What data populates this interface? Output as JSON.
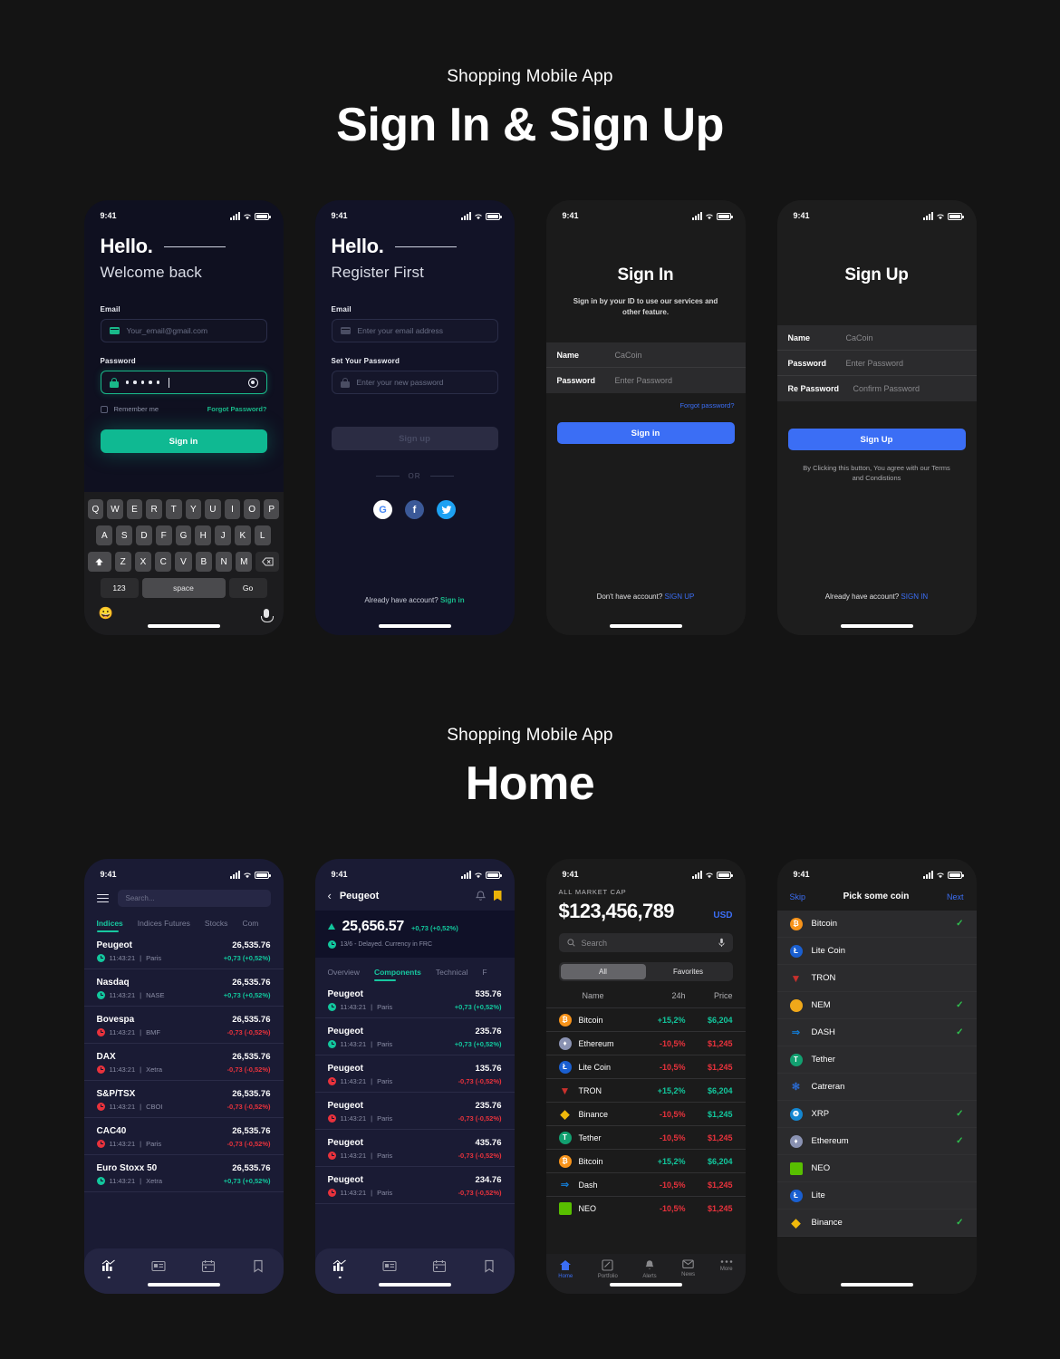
{
  "sections": [
    {
      "subtitle": "Shopping Mobile App",
      "title": "Sign In & Sign Up"
    },
    {
      "subtitle": "Shopping Mobile App",
      "title": "Home"
    }
  ],
  "status_bar": {
    "time": "9:41"
  },
  "screen_signin_dark": {
    "hello": "Hello.",
    "welcome": "Welcome back",
    "email_label": "Email",
    "email_placeholder": "Your_email@gmail.com",
    "email_icon": "mail-icon",
    "password_label": "Password",
    "password_icon": "lock-icon",
    "password_masked": "•••••",
    "eye_icon": "eye-icon",
    "remember_label": "Remember me",
    "forgot_label": "Forgot Password?",
    "signin_button": "Sign in",
    "accent": "#0fb992",
    "keyboard": {
      "row1": [
        "Q",
        "W",
        "E",
        "R",
        "T",
        "Y",
        "U",
        "I",
        "O",
        "P"
      ],
      "row2": [
        "A",
        "S",
        "D",
        "F",
        "G",
        "H",
        "J",
        "K",
        "L"
      ],
      "row3": [
        "Z",
        "X",
        "C",
        "V",
        "B",
        "N",
        "M"
      ],
      "shift_icon": "shift-icon",
      "backspace_icon": "backspace-icon",
      "numbers_key": "123",
      "space_key": "space",
      "go_key": "Go",
      "emoji_icon": "emoji-icon",
      "mic_icon": "microphone-icon"
    }
  },
  "screen_signup_dark": {
    "hello": "Hello.",
    "register": "Register First",
    "email_label": "Email",
    "email_placeholder": "Enter your email address",
    "password_label": "Set Your Password",
    "password_placeholder": "Enter your new password",
    "signup_button": "Sign up",
    "or_label": "OR",
    "socials": [
      {
        "name": "google-icon",
        "glyph": "G",
        "color": "#ffffff"
      },
      {
        "name": "facebook-icon",
        "glyph": "f",
        "color": "#3b5998"
      },
      {
        "name": "twitter-icon",
        "glyph": "t",
        "color": "#1da1f2"
      }
    ],
    "bottom_text": "Already have account?",
    "bottom_link": "Sign in"
  },
  "screen_ios_signin": {
    "title": "Sign In",
    "subtitle": "Sign in by your ID to use our services and other feature.",
    "fields": [
      {
        "label": "Name",
        "value": "CaCoin"
      },
      {
        "label": "Password",
        "value": "Enter Password"
      }
    ],
    "forgot": "Forgot password?",
    "button": "Sign in",
    "bottom_text": "Don't have account?",
    "bottom_link": "SIGN UP",
    "accent": "#3b6ef5"
  },
  "screen_ios_signup": {
    "title": "Sign Up",
    "fields": [
      {
        "label": "Name",
        "value": "CaCoin"
      },
      {
        "label": "Password",
        "value": "Enter Password"
      },
      {
        "label": "Re Password",
        "value": "Confirm Password"
      }
    ],
    "button": "Sign Up",
    "terms": "By Clicking this button, You agree with our Terms and Condistions",
    "bottom_text": "Already have account?",
    "bottom_link": "SIGN IN"
  },
  "screen_home_indices": {
    "menu_icon": "hamburger-icon",
    "search_placeholder": "Search...",
    "tabs": [
      "Indices",
      "Indices Futures",
      "Stocks",
      "Com"
    ],
    "active_tab": "Indices",
    "rows": [
      {
        "name": "Peugeot",
        "price": "26,535.76",
        "time": "11:43:21",
        "market": "Paris",
        "change": "+0,73 (+0,52%)",
        "dir": "up"
      },
      {
        "name": "Nasdaq",
        "price": "26,535.76",
        "time": "11:43:21",
        "market": "NASE",
        "change": "+0,73 (+0,52%)",
        "dir": "up"
      },
      {
        "name": "Bovespa",
        "price": "26,535.76",
        "time": "11:43:21",
        "market": "BMF",
        "change": "-0,73 (-0,52%)",
        "dir": "down"
      },
      {
        "name": "DAX",
        "price": "26,535.76",
        "time": "11:43:21",
        "market": "Xetra",
        "change": "-0,73 (-0,52%)",
        "dir": "down"
      },
      {
        "name": "S&P/TSX",
        "price": "26,535.76",
        "time": "11:43:21",
        "market": "CBOI",
        "change": "-0,73 (-0,52%)",
        "dir": "down"
      },
      {
        "name": "CAC40",
        "price": "26,535.76",
        "time": "11:43:21",
        "market": "Paris",
        "change": "-0,73 (-0,52%)",
        "dir": "down"
      },
      {
        "name": "Euro Stoxx 50",
        "price": "26,535.76",
        "time": "11:43:21",
        "market": "Xetra",
        "change": "+0,73 (+0,52%)",
        "dir": "up"
      }
    ],
    "nav_icons": [
      "chart-icon",
      "news-icon",
      "calendar-icon",
      "bookmark-icon"
    ]
  },
  "screen_home_detail": {
    "back_icon": "chevron-left-icon",
    "title": "Peugeot",
    "bell_icon": "bell-icon",
    "bookmark_icon": "bookmark-icon",
    "price": "25,656.57",
    "change": "+0,73 (+0,52%)",
    "meta": "13/6 - Delayed. Currency in FRC",
    "tabs": [
      "Overview",
      "Components",
      "Technical",
      "F"
    ],
    "active_tab": "Components",
    "rows": [
      {
        "name": "Peugeot",
        "price": "535.76",
        "time": "11:43:21",
        "market": "Paris",
        "change": "+0,73 (+0,52%)",
        "dir": "up"
      },
      {
        "name": "Peugeot",
        "price": "235.76",
        "time": "11:43:21",
        "market": "Paris",
        "change": "+0,73 (+0,52%)",
        "dir": "up"
      },
      {
        "name": "Peugeot",
        "price": "135.76",
        "time": "11:43:21",
        "market": "Paris",
        "change": "-0,73 (-0,52%)",
        "dir": "down"
      },
      {
        "name": "Peugeot",
        "price": "235.76",
        "time": "11:43:21",
        "market": "Paris",
        "change": "-0,73 (-0,52%)",
        "dir": "down"
      },
      {
        "name": "Peugeot",
        "price": "435.76",
        "time": "11:43:21",
        "market": "Paris",
        "change": "-0,73 (-0,52%)",
        "dir": "down"
      },
      {
        "name": "Peugeot",
        "price": "234.76",
        "time": "11:43:21",
        "market": "Paris",
        "change": "-0,73 (-0,52%)",
        "dir": "down"
      }
    ]
  },
  "screen_market_cap": {
    "label": "ALL MARKET CAP",
    "amount": "$123,456,789",
    "currency": "USD",
    "search_placeholder": "Search",
    "search_icon": "search-icon",
    "mic_icon": "microphone-icon",
    "segments": [
      "All",
      "Favorites"
    ],
    "active_segment": "All",
    "columns": [
      "Name",
      "24h",
      "Price"
    ],
    "rows": [
      {
        "name": "Bitcoin",
        "change": "+15,2%",
        "price": "$6,204",
        "chg_dir": "up",
        "price_dir": "up",
        "icon": "bitcoin-icon",
        "color": "#f7931a",
        "glyph": "Ƀ"
      },
      {
        "name": "Ethereum",
        "change": "-10,5%",
        "price": "$1,245",
        "chg_dir": "down",
        "price_dir": "down",
        "icon": "ethereum-icon",
        "color": "#8a92b2",
        "glyph": "Ξ"
      },
      {
        "name": "Lite Coin",
        "change": "-10,5%",
        "price": "$1,245",
        "chg_dir": "down",
        "price_dir": "down",
        "icon": "litecoin-icon",
        "color": "#1a5fd0",
        "glyph": "Ł"
      },
      {
        "name": "TRON",
        "change": "+15,2%",
        "price": "$6,204",
        "chg_dir": "up",
        "price_dir": "up",
        "icon": "tron-icon",
        "color": "#c9302c",
        "glyph": "▽"
      },
      {
        "name": "Binance",
        "change": "-10,5%",
        "price": "$1,245",
        "chg_dir": "down",
        "price_dir": "up",
        "icon": "binance-icon",
        "color": "#f0b90b",
        "glyph": "◆"
      },
      {
        "name": "Tether",
        "change": "-10,5%",
        "price": "$1,245",
        "chg_dir": "down",
        "price_dir": "down",
        "icon": "tether-icon",
        "color": "#12a070",
        "glyph": "T"
      },
      {
        "name": "Bitcoin",
        "change": "+15,2%",
        "price": "$6,204",
        "chg_dir": "up",
        "price_dir": "up",
        "icon": "bitcoin-icon",
        "color": "#f7931a",
        "glyph": "Ƀ"
      },
      {
        "name": "Dash",
        "change": "-10,5%",
        "price": "$1,245",
        "chg_dir": "down",
        "price_dir": "down",
        "icon": "dash-icon",
        "color": "#1478cd",
        "glyph": "Đ"
      },
      {
        "name": "NEO",
        "change": "-10,5%",
        "price": "$1,245",
        "chg_dir": "down",
        "price_dir": "down",
        "icon": "neo-icon",
        "color": "#58bf00",
        "glyph": "◢"
      }
    ],
    "tabbar": [
      {
        "label": "Home",
        "icon": "home-icon",
        "active": true
      },
      {
        "label": "Portfolio",
        "icon": "portfolio-icon",
        "active": false
      },
      {
        "label": "Alerts",
        "icon": "bell-icon",
        "active": false
      },
      {
        "label": "News",
        "icon": "mail-icon",
        "active": false
      },
      {
        "label": "More",
        "icon": "more-icon",
        "active": false
      }
    ]
  },
  "screen_pick_coin": {
    "skip": "Skip",
    "title": "Pick some coin",
    "next": "Next",
    "check_icon": "check-icon",
    "rows": [
      {
        "name": "Bitcoin",
        "selected": true,
        "icon": "bitcoin-icon",
        "color": "#f7931a",
        "glyph": "Ƀ"
      },
      {
        "name": "Lite Coin",
        "selected": false,
        "icon": "litecoin-icon",
        "color": "#1a5fd0",
        "glyph": "Ł"
      },
      {
        "name": "TRON",
        "selected": false,
        "icon": "tron-icon",
        "color": "#c9302c",
        "glyph": "▽"
      },
      {
        "name": "NEM",
        "selected": true,
        "icon": "nem-icon",
        "color": "#f0a81a",
        "glyph": "◔"
      },
      {
        "name": "DASH",
        "selected": true,
        "icon": "dash-icon",
        "color": "#1478cd",
        "glyph": "Đ"
      },
      {
        "name": "Tether",
        "selected": false,
        "icon": "tether-icon",
        "color": "#12a070",
        "glyph": "T"
      },
      {
        "name": "Catreran",
        "selected": false,
        "icon": "cardano-icon",
        "color": "#2a4a8a",
        "glyph": "✻"
      },
      {
        "name": "XRP",
        "selected": true,
        "icon": "xrp-icon",
        "color": "#1486d0",
        "glyph": "✤"
      },
      {
        "name": "Ethereum",
        "selected": true,
        "icon": "ethereum-icon",
        "color": "#8a92b2",
        "glyph": "Ξ"
      },
      {
        "name": "NEO",
        "selected": false,
        "icon": "neo-icon",
        "color": "#58bf00",
        "glyph": "◢"
      },
      {
        "name": "Lite",
        "selected": false,
        "icon": "litecoin-icon",
        "color": "#1a5fd0",
        "glyph": "Ł"
      },
      {
        "name": "Binance",
        "selected": true,
        "icon": "binance-icon",
        "color": "#f0b90b",
        "glyph": "◆"
      }
    ]
  }
}
